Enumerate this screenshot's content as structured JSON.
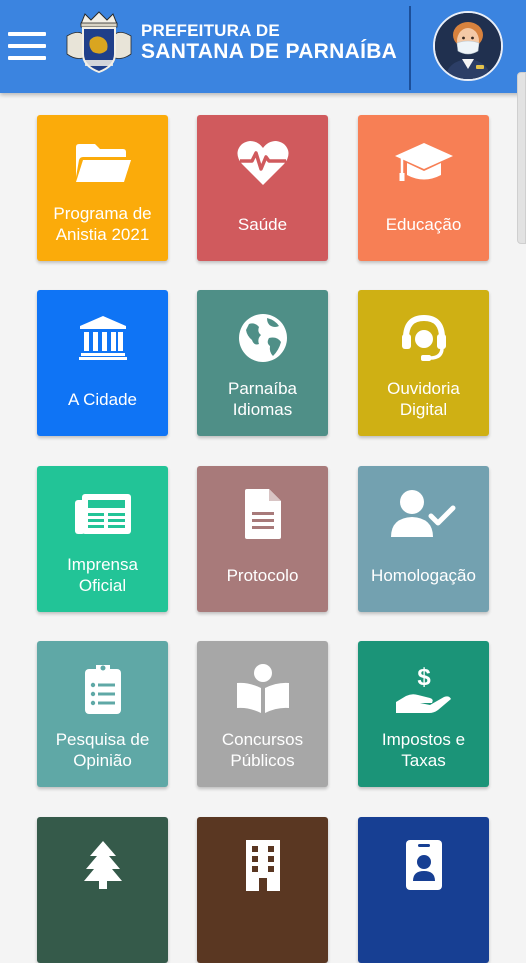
{
  "header": {
    "title_line1": "PREFEITURA DE",
    "title_line2": "SANTANA DE PARNAÍBA",
    "background": "#3b84e0"
  },
  "tiles": [
    {
      "label": "Programa de\nAnistia 2021",
      "icon": "folder-icon",
      "color": "#fbab0a"
    },
    {
      "label": "Saúde",
      "icon": "heart-pulse-icon",
      "color": "#d05a5d"
    },
    {
      "label": "Educação",
      "icon": "graduation-cap-icon",
      "color": "#f77f55"
    },
    {
      "label": "A Cidade",
      "icon": "city-hall-icon",
      "color": "#0f74f5"
    },
    {
      "label": "Parnaíba\nIdiomas",
      "icon": "globe-icon",
      "color": "#4f8f87"
    },
    {
      "label": "Ouvidoria\nDigital",
      "icon": "headset-icon",
      "color": "#cfb014"
    },
    {
      "label": "Imprensa\nOficial",
      "icon": "newspaper-icon",
      "color": "#22c497"
    },
    {
      "label": "Protocolo",
      "icon": "document-icon",
      "color": "#a87a7a"
    },
    {
      "label": "Homologação",
      "icon": "user-check-icon",
      "color": "#73a1b0"
    },
    {
      "label": "Pesquisa de\nOpinião",
      "icon": "clipboard-list-icon",
      "color": "#5fa8a6"
    },
    {
      "label": "Concursos\nPúblicos",
      "icon": "reader-book-icon",
      "color": "#a7a7a7"
    },
    {
      "label": "Impostos e\nTaxas",
      "icon": "hand-money-icon",
      "color": "#1b9478"
    },
    {
      "label": "",
      "icon": "tree-icon",
      "color": "#355a4a"
    },
    {
      "label": "",
      "icon": "building-icon",
      "color": "#5a3722"
    },
    {
      "label": "",
      "icon": "id-badge-icon",
      "color": "#173f93"
    }
  ]
}
